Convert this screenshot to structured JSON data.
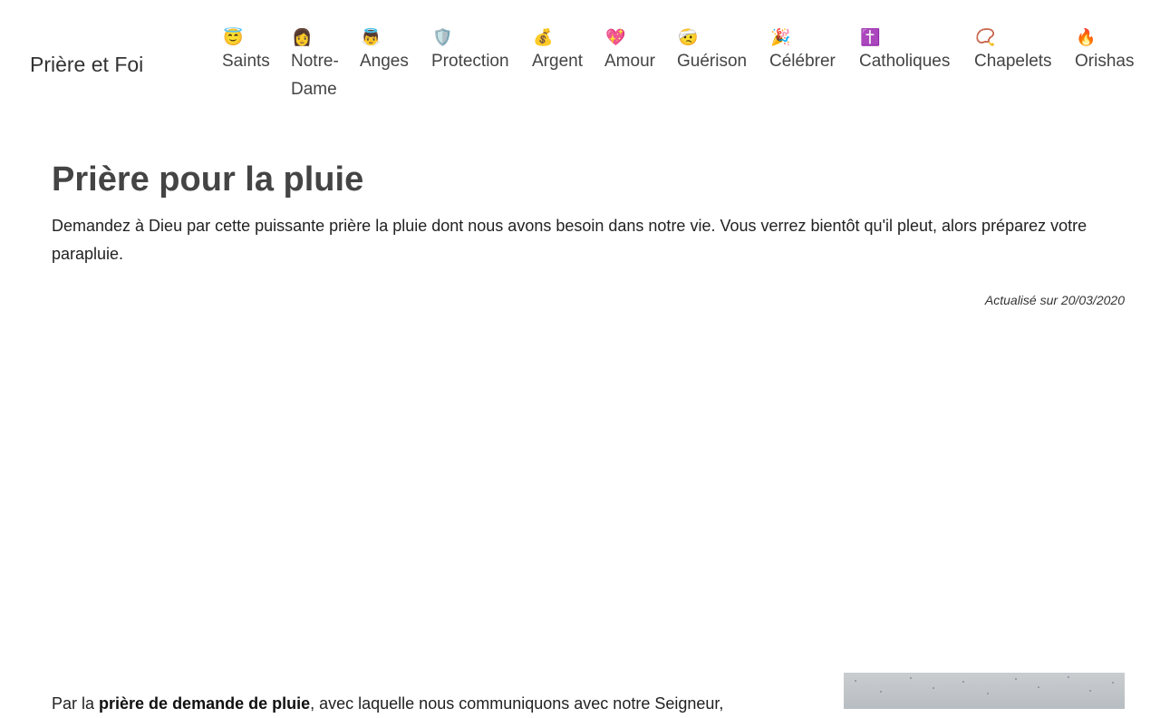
{
  "site": {
    "brand": "Prière et Foi"
  },
  "nav": [
    {
      "icon": "😇",
      "icon_name": "smiling-face-with-halo-icon",
      "label": "Saints"
    },
    {
      "icon": "👩",
      "icon_name": "woman-icon",
      "label": "Notre-Dame"
    },
    {
      "icon": "👼",
      "icon_name": "baby-angel-icon",
      "label": "Anges"
    },
    {
      "icon": "🛡️",
      "icon_name": "shield-icon",
      "label": "Protection"
    },
    {
      "icon": "💰",
      "icon_name": "money-bag-icon",
      "label": "Argent"
    },
    {
      "icon": "💖",
      "icon_name": "sparkling-heart-icon",
      "label": "Amour"
    },
    {
      "icon": "🤕",
      "icon_name": "face-with-bandage-icon",
      "label": "Guérison"
    },
    {
      "icon": "🎉",
      "icon_name": "party-popper-icon",
      "label": "Célébrer"
    },
    {
      "icon": "✝️",
      "icon_name": "latin-cross-icon",
      "label": "Catholiques"
    },
    {
      "icon": "📿",
      "icon_name": "prayer-beads-icon",
      "label": "Chapelets"
    },
    {
      "icon": "🔥",
      "icon_name": "fire-icon",
      "label": "Orishas"
    }
  ],
  "article": {
    "title": "Prière pour la pluie",
    "lead": "Demandez à Dieu par cette puissante prière la pluie dont nous avons besoin dans notre vie. Vous verrez bientôt qu'il pleut, alors préparez votre parapluie.",
    "updated": "Actualisé sur 20/03/2020",
    "intro_prefix": "Par la ",
    "intro_bold": "prière de demande de pluie",
    "intro_suffix": ", avec laquelle nous communiquons avec notre Seigneur,"
  }
}
